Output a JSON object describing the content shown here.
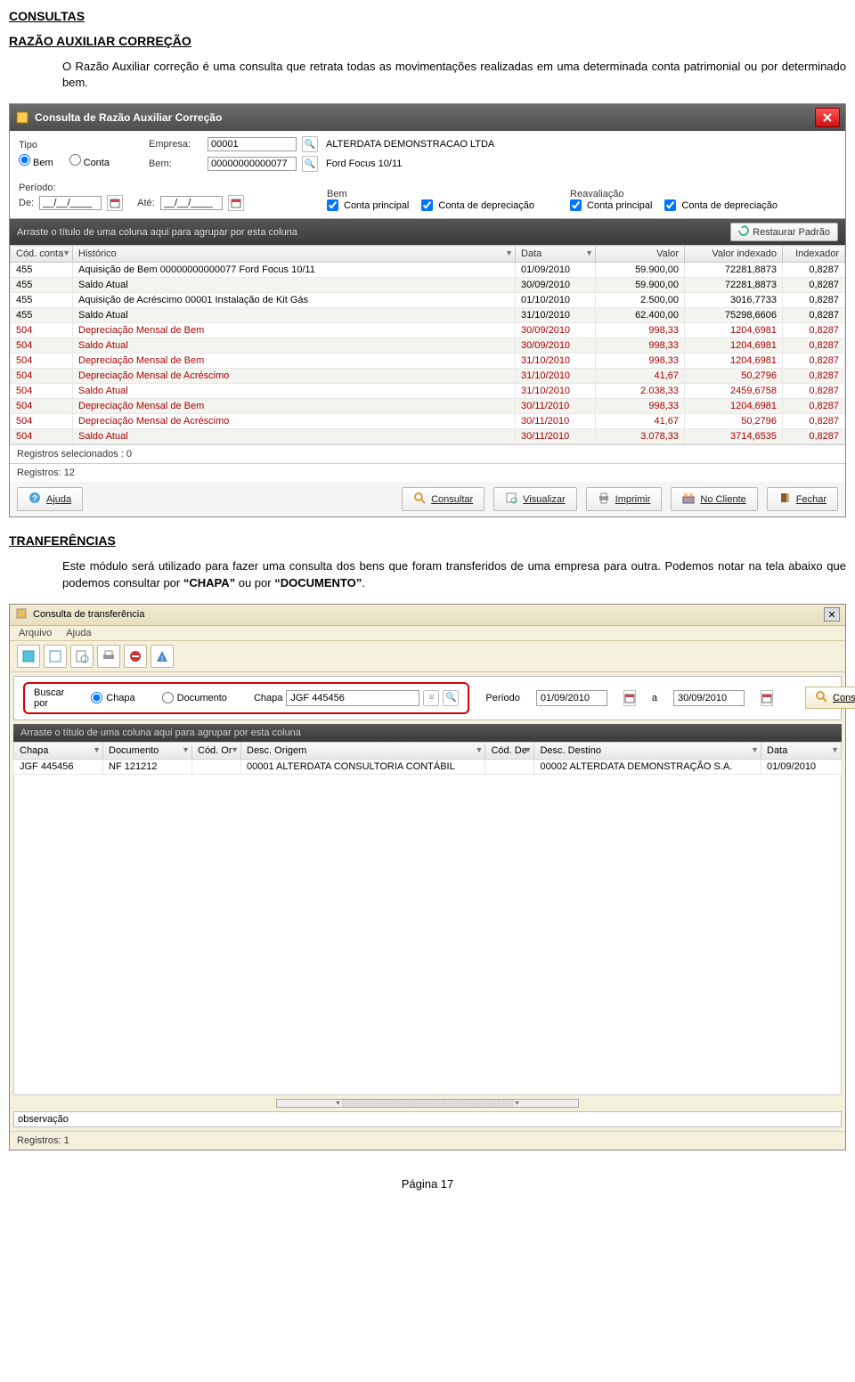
{
  "section1": {
    "title": "CONSULTAS",
    "subtitle": "RAZÃO AUXILIAR CORREÇÃO",
    "paragraph": "O Razão Auxiliar correção é uma consulta que retrata todas as movimentações realizadas em uma determinada conta patrimonial ou por determinado bem."
  },
  "window1": {
    "title": "Consulta de Razão Auxiliar Correção",
    "tipo_label": "Tipo",
    "radio_bem": "Bem",
    "radio_conta": "Conta",
    "empresa_label": "Empresa:",
    "empresa_code": "00001",
    "empresa_name": "ALTERDATA DEMONSTRACAO LTDA",
    "bem_label": "Bem:",
    "bem_code": "00000000000077",
    "bem_name": "Ford Focus 10/11",
    "periodo_label": "Período:",
    "de_label": "De:",
    "de_value": "__/__/____",
    "ate_label": "Até:",
    "ate_value": "__/__/____",
    "grp_bem": "Bem",
    "grp_reav": "Reavaliação",
    "chk_conta_principal": "Conta principal",
    "chk_conta_deprec": "Conta de depreciação",
    "groupbar_text": "Arraste o título de uma coluna aqui para agrupar por esta coluna",
    "restore_label": "Restaurar Padrão",
    "columns": {
      "cod": "Cód. conta",
      "hist": "Histórico",
      "data": "Data",
      "valor": "Valor",
      "valor_idx": "Valor indexado",
      "idx": "Indexador"
    },
    "rows": [
      {
        "cod": "455",
        "hist": "Aquisição  de Bem 00000000000077 Ford Focus 10/11",
        "data": "01/09/2010",
        "valor": "59.900,00",
        "valor_idx": "72281,8873",
        "idx": "0,8287",
        "red": false
      },
      {
        "cod": "455",
        "hist": "Saldo Atual",
        "data": "30/09/2010",
        "valor": "59.900,00",
        "valor_idx": "72281,8873",
        "idx": "0,8287",
        "red": false
      },
      {
        "cod": "455",
        "hist": "Aquisição  de Acréscimo 00001 Instalação de Kit Gás",
        "data": "01/10/2010",
        "valor": "2.500,00",
        "valor_idx": "3016,7733",
        "idx": "0,8287",
        "red": false
      },
      {
        "cod": "455",
        "hist": "Saldo Atual",
        "data": "31/10/2010",
        "valor": "62.400,00",
        "valor_idx": "75298,6606",
        "idx": "0,8287",
        "red": false
      },
      {
        "cod": "504",
        "hist": "Depreciação Mensal de Bem",
        "data": "30/09/2010",
        "valor": "998,33",
        "valor_idx": "1204,6981",
        "idx": "0,8287",
        "red": true
      },
      {
        "cod": "504",
        "hist": "Saldo Atual",
        "data": "30/09/2010",
        "valor": "998,33",
        "valor_idx": "1204,6981",
        "idx": "0,8287",
        "red": true
      },
      {
        "cod": "504",
        "hist": "Depreciação Mensal de Bem",
        "data": "31/10/2010",
        "valor": "998,33",
        "valor_idx": "1204,6981",
        "idx": "0,8287",
        "red": true
      },
      {
        "cod": "504",
        "hist": "Depreciação Mensal de Acréscimo",
        "data": "31/10/2010",
        "valor": "41,67",
        "valor_idx": "50,2796",
        "idx": "0,8287",
        "red": true
      },
      {
        "cod": "504",
        "hist": "Saldo Atual",
        "data": "31/10/2010",
        "valor": "2.038,33",
        "valor_idx": "2459,6758",
        "idx": "0,8287",
        "red": true
      },
      {
        "cod": "504",
        "hist": "Depreciação Mensal de Bem",
        "data": "30/11/2010",
        "valor": "998,33",
        "valor_idx": "1204,6981",
        "idx": "0,8287",
        "red": true
      },
      {
        "cod": "504",
        "hist": "Depreciação Mensal de Acréscimo",
        "data": "30/11/2010",
        "valor": "41,67",
        "valor_idx": "50,2796",
        "idx": "0,8287",
        "red": true
      },
      {
        "cod": "504",
        "hist": "Saldo Atual",
        "data": "30/11/2010",
        "valor": "3.078,33",
        "valor_idx": "3714,6535",
        "idx": "0,8287",
        "red": true
      }
    ],
    "sel_label": "Registros selecionados : 0",
    "count_label": "Registros: 12",
    "btn_ajuda": "Ajuda",
    "btn_consultar": "Consultar",
    "btn_visualizar": "Visualizar",
    "btn_imprimir": "Imprimir",
    "btn_nocliente": "No Cliente",
    "btn_fechar": "Fechar"
  },
  "section2": {
    "title": "TRANFERÊNCIAS",
    "paragraph_prefix": "Este módulo será utilizado para fazer uma consulta dos bens que foram transferidos de uma empresa para outra. Podemos notar na tela abaixo que podemos consultar por ",
    "chapa_strong": "“CHAPA”",
    "paragraph_mid": " ou por ",
    "documento_strong": "“DOCUMENTO”",
    "paragraph_end": "."
  },
  "window2": {
    "title": "Consulta de transferência",
    "menu_arquivo": "Arquivo",
    "menu_ajuda": "Ajuda",
    "buscar_legend": "Buscar por",
    "radio_chapa": "Chapa",
    "radio_documento": "Documento",
    "chapa_label": "Chapa",
    "chapa_value": "JGF 445456",
    "periodo_label": "Período",
    "periodo_de": "01/09/2010",
    "a_label": "a",
    "periodo_ate": "30/09/2010",
    "consultar": "Consultar",
    "groupbar_text": "Arraste o título de uma coluna aqui para agrupar por esta coluna",
    "columns": {
      "chapa": "Chapa",
      "documento": "Documento",
      "cod_or": "Cód. Or",
      "desc_origem": "Desc. Origem",
      "cod_de": "Cód. De",
      "desc_destino": "Desc. Destino",
      "data": "Data"
    },
    "row": {
      "chapa": "JGF 445456",
      "documento": "NF 121212",
      "cod_or": "",
      "desc_origem": "00001 ALTERDATA CONSULTORIA CONTÁBIL",
      "cod_de": "",
      "desc_destino": "00002 ALTERDATA DEMONSTRAÇÃO S.A.",
      "data": "01/09/2010"
    },
    "obs_label": "observação",
    "count_label": "Registros: 1"
  },
  "footer": "Página 17"
}
